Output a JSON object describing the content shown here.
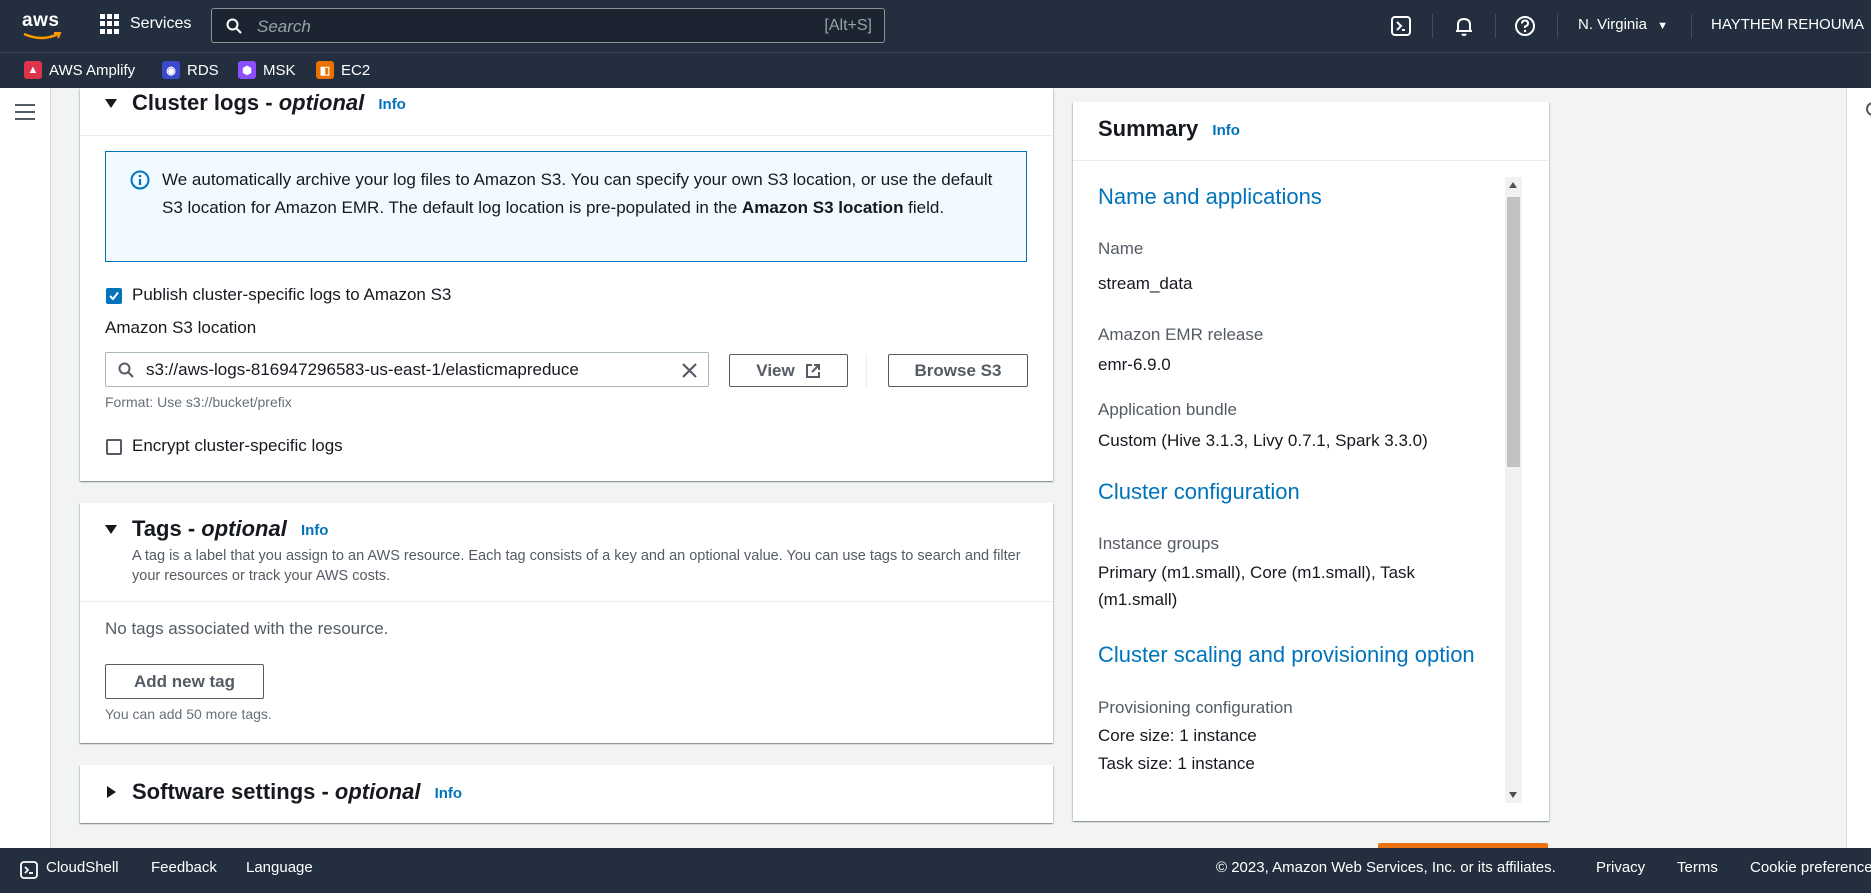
{
  "topnav": {
    "logo": "aws",
    "services_label": "Services",
    "search_placeholder": "Search",
    "search_shortcut": "[Alt+S]",
    "region": "N. Virginia",
    "user": "HAYTHEM REHOUMA",
    "icons": [
      "cloudshell-icon",
      "bell-icon",
      "help-icon"
    ]
  },
  "favorites": [
    {
      "label": "AWS Amplify",
      "color": "#dd344c"
    },
    {
      "label": "RDS",
      "color": "#3b48cc"
    },
    {
      "label": "MSK",
      "color": "#8c4fff"
    },
    {
      "label": "EC2",
      "color": "#ed7100"
    }
  ],
  "cluster_logs": {
    "title": "Cluster logs - ",
    "title_optional": "optional",
    "info": "Info",
    "alert_text_1": "We automatically archive your log files to Amazon S3. You can specify your own S3 location, or use the default S3 location for Amazon EMR. The default log location is pre-populated in the ",
    "alert_text_bold": "Amazon S3 location",
    "alert_text_2": " field.",
    "publish_label": "Publish cluster-specific logs to Amazon S3",
    "publish_checked": true,
    "s3_location_label": "Amazon S3 location",
    "s3_location_value": "s3://aws-logs-816947296583-us-east-1/elasticmapreduce",
    "s3_format_hint": "Format: Use s3://bucket/prefix",
    "view_button": "View",
    "browse_button": "Browse S3",
    "encrypt_label": "Encrypt cluster-specific logs",
    "encrypt_checked": false
  },
  "tags": {
    "title": "Tags - ",
    "title_optional": "optional",
    "info": "Info",
    "description": "A tag is a label that you assign to an AWS resource. Each tag consists of a key and an optional value. You can use tags to search and filter your resources or track your AWS costs.",
    "empty_text": "No tags associated with the resource.",
    "add_button": "Add new tag",
    "limit_hint": "You can add 50 more tags."
  },
  "software_settings": {
    "title": "Software settings - ",
    "title_optional": "optional",
    "info": "Info"
  },
  "summary": {
    "title": "Summary",
    "info": "Info",
    "section_name_apps": "Name and applications",
    "name_key": "Name",
    "name_val": "stream_data",
    "release_key": "Amazon EMR release",
    "release_val": "emr-6.9.0",
    "bundle_key": "Application bundle",
    "bundle_val": "Custom (Hive 3.1.3, Livy 0.7.1, Spark 3.3.0)",
    "section_cluster_config": "Cluster configuration",
    "instance_groups_key": "Instance groups",
    "instance_groups_val": "Primary (m1.small), Core (m1.small), Task (m1.small)",
    "section_scaling": "Cluster scaling and provisioning option",
    "provisioning_key": "Provisioning configuration",
    "core_size": "Core size: 1 instance",
    "task_size": "Task size: 1 instance"
  },
  "footer": {
    "cloudshell": "CloudShell",
    "feedback": "Feedback",
    "language": "Language",
    "copyright": "© 2023, Amazon Web Services, Inc. or its affiliates.",
    "privacy": "Privacy",
    "terms": "Terms",
    "cookie": "Cookie preferences"
  }
}
